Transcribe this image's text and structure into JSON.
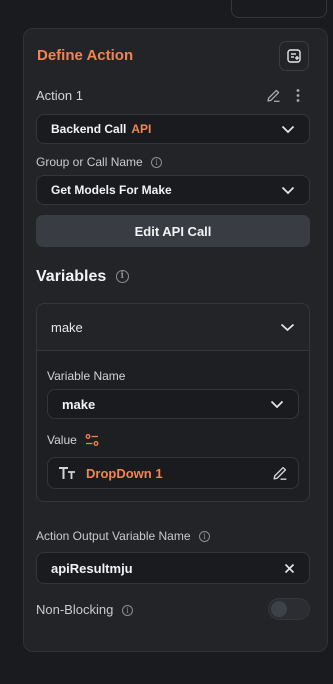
{
  "panel": {
    "title": "Define Action",
    "action_label": "Action 1",
    "action_type": {
      "main": "Backend Call",
      "accent": "API"
    },
    "group_label": "Group or Call Name",
    "group_value": "Get Models For Make",
    "edit_button": "Edit API Call",
    "variables_title": "Variables",
    "variable": {
      "header": "make",
      "name_label": "Variable Name",
      "name_value": "make",
      "value_label": "Value",
      "value_source": "DropDown 1"
    },
    "output_label": "Action Output Variable Name",
    "output_value": "apiResultmju",
    "non_blocking_label": "Non-Blocking",
    "non_blocking_enabled": false
  },
  "colors": {
    "accent": "#f08552",
    "panel_bg": "#232428",
    "field_bg": "#1a1b1f",
    "button_bg": "#3a3c43"
  }
}
